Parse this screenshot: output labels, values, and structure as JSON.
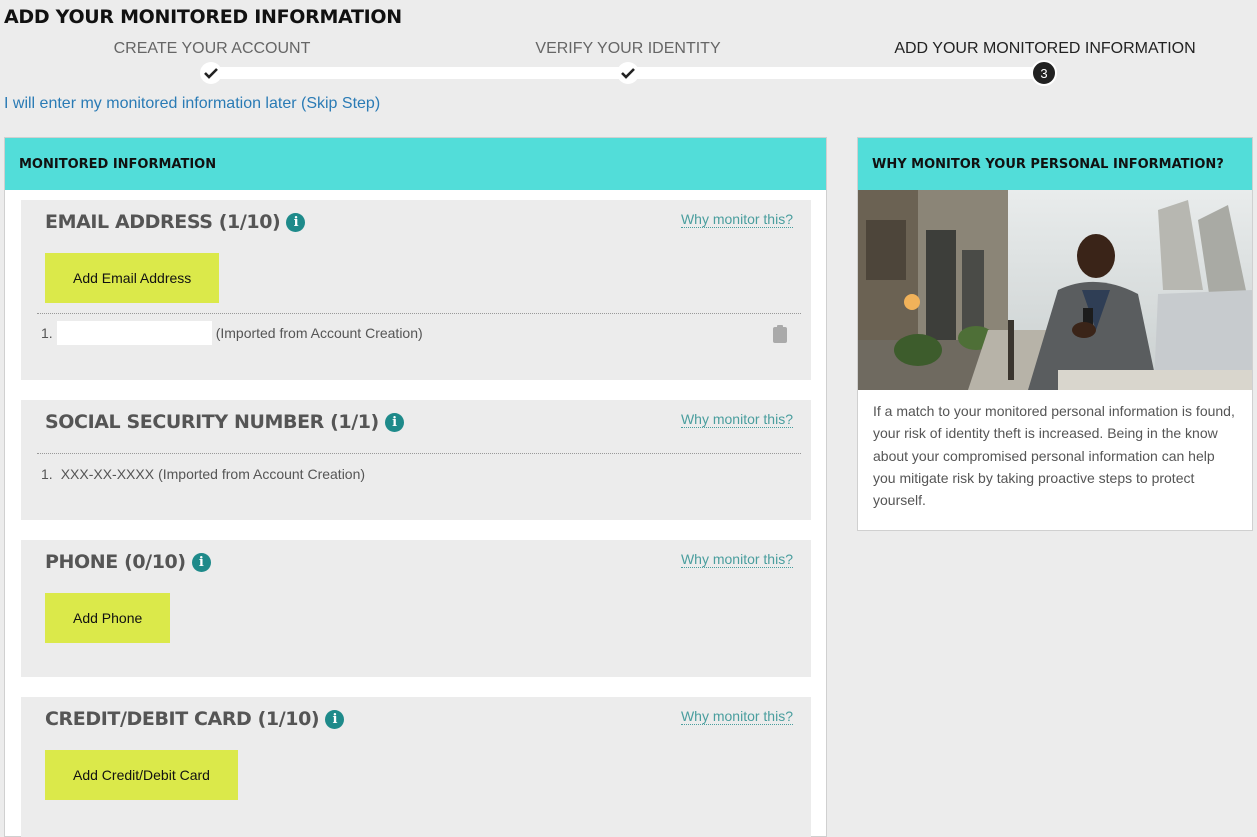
{
  "page": {
    "title": "ADD YOUR MONITORED INFORMATION"
  },
  "steps": [
    {
      "label": "CREATE YOUR ACCOUNT",
      "status": "done"
    },
    {
      "label": "VERIFY YOUR IDENTITY",
      "status": "done"
    },
    {
      "label": "ADD YOUR MONITORED INFORMATION",
      "status": "current",
      "number": "3"
    }
  ],
  "skip_link": "I will enter my monitored information later (Skip Step)",
  "monitored": {
    "header": "MONITORED INFORMATION",
    "why_label": "Why monitor this?",
    "sections": {
      "email": {
        "title": "EMAIL ADDRESS (1/10)",
        "button": "Add Email Address",
        "items": [
          {
            "num": "1.",
            "value": "",
            "note": "(Imported from Account Creation)"
          }
        ]
      },
      "ssn": {
        "title": "SOCIAL SECURITY NUMBER (1/1)",
        "items": [
          {
            "num": "1.",
            "value": "XXX-XX-XXXX",
            "note": "(Imported from Account Creation)"
          }
        ]
      },
      "phone": {
        "title": "PHONE (0/10)",
        "button": "Add Phone"
      },
      "card": {
        "title": "CREDIT/DEBIT CARD (1/10)",
        "button": "Add Credit/Debit Card"
      }
    }
  },
  "why_panel": {
    "header": "WHY MONITOR YOUR PERSONAL INFORMATION?",
    "text": "If a match to your monitored personal information is found, your risk of identity theft is increased. Being in the know about your compromised personal information can help you mitigate risk by taking proactive steps to protect yourself."
  },
  "colors": {
    "accent": "#52ddd9",
    "button": "#dbe94a",
    "link": "#2a7bb5",
    "info": "#1e8a8a"
  }
}
